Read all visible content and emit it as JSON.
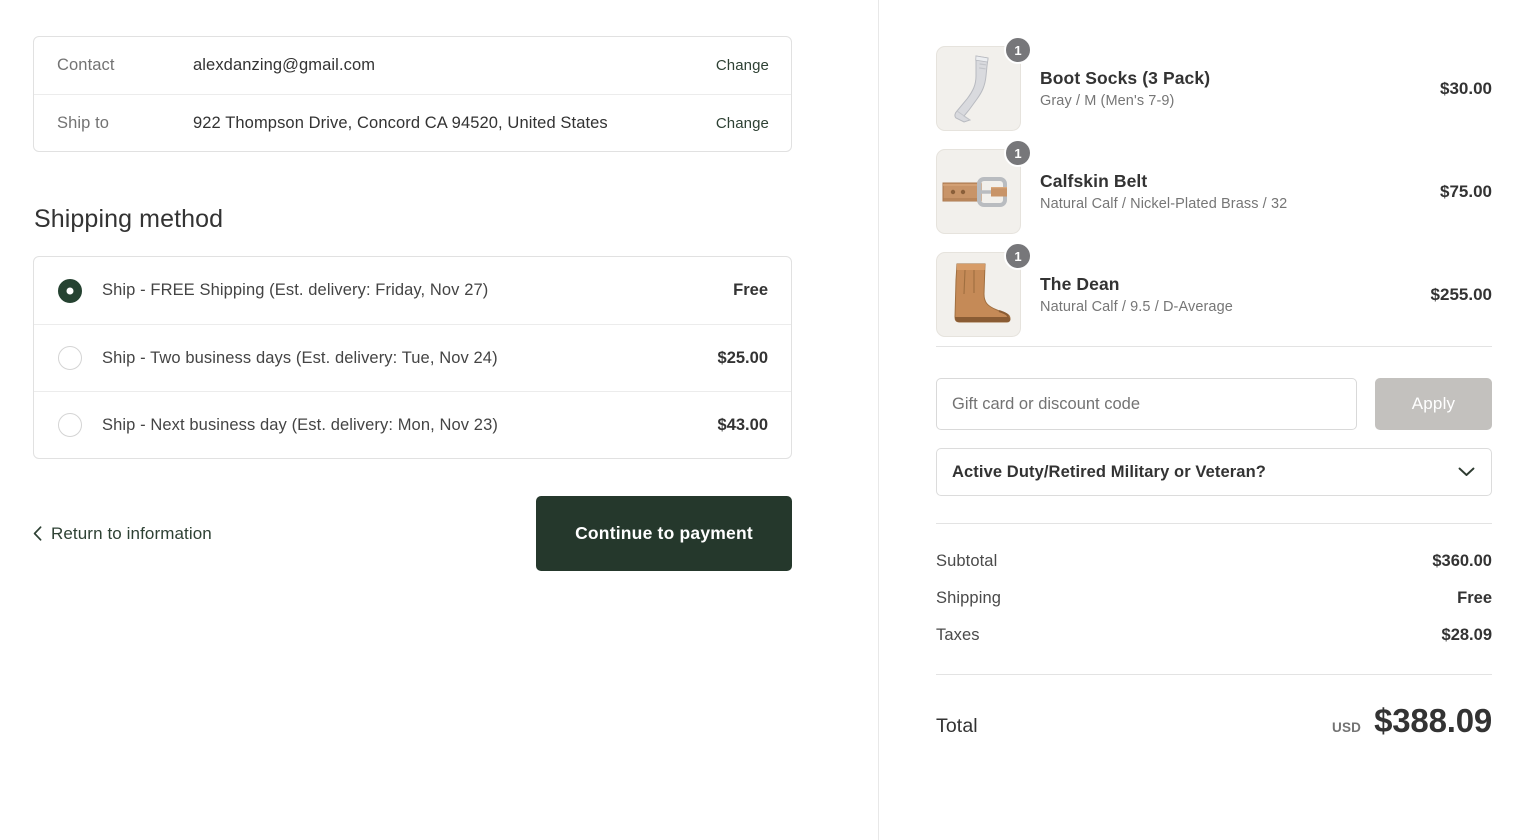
{
  "summary": {
    "rows": [
      {
        "label": "Contact",
        "value": "alexdanzing@gmail.com",
        "action": "Change"
      },
      {
        "label": "Ship to",
        "value": "922 Thompson Drive, Concord CA 94520, United States",
        "action": "Change"
      }
    ]
  },
  "shipping": {
    "section_title": "Shipping method",
    "options": [
      {
        "label": "Ship - FREE Shipping (Est. delivery: Friday, Nov 27)",
        "price": "Free",
        "selected": true
      },
      {
        "label": "Ship - Two business days (Est. delivery: Tue, Nov 24)",
        "price": "$25.00",
        "selected": false
      },
      {
        "label": "Ship - Next business day (Est. delivery: Mon, Nov 23)",
        "price": "$43.00",
        "selected": false
      }
    ]
  },
  "actions": {
    "return_label": "Return to information",
    "continue_label": "Continue to payment"
  },
  "order": {
    "items": [
      {
        "qty": "1",
        "title": "Boot Socks (3 Pack)",
        "variant": "Gray / M (Men's 7-9)",
        "price": "$30.00",
        "image": "sock-thumbnail"
      },
      {
        "qty": "1",
        "title": "Calfskin Belt",
        "variant": "Natural Calf / Nickel-Plated Brass / 32",
        "price": "$75.00",
        "image": "belt-thumbnail"
      },
      {
        "qty": "1",
        "title": "The Dean",
        "variant": "Natural Calf / 9.5 / D-Average",
        "price": "$255.00",
        "image": "boot-thumbnail"
      }
    ],
    "discount": {
      "placeholder": "Gift card or discount code",
      "value": "",
      "apply_label": "Apply"
    },
    "military": {
      "label": "Active Duty/Retired Military or Veteran?"
    },
    "totals": [
      {
        "key": "Subtotal",
        "value": "$360.00"
      },
      {
        "key": "Shipping",
        "value": "Free"
      },
      {
        "key": "Taxes",
        "value": "$28.09"
      }
    ],
    "grand_total": {
      "key": "Total",
      "currency": "USD",
      "amount": "$388.09"
    }
  },
  "colors": {
    "accent_green": "#25382c",
    "link_green": "#2e4134",
    "disabled_gray": "#c3c1be",
    "badge_gray": "#77777a"
  }
}
